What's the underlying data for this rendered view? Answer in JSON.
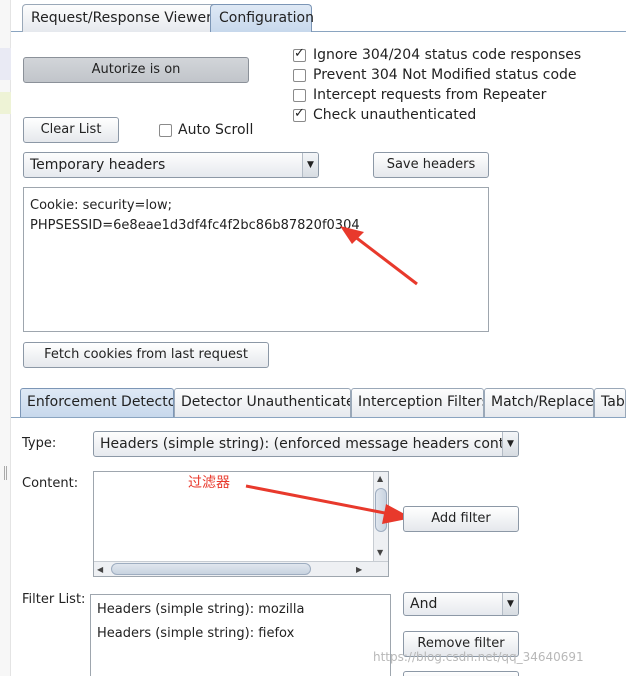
{
  "top_tabs": [
    {
      "label": "Request/Response Viewers",
      "selected": false
    },
    {
      "label": "Configuration",
      "selected": true
    }
  ],
  "config": {
    "autorize_button": "Autorize is on",
    "clear_list_button": "Clear List",
    "auto_scroll_label": "Auto Scroll",
    "auto_scroll_checked": false,
    "options": [
      {
        "label": "Ignore 304/204 status code responses",
        "checked": true
      },
      {
        "label": "Prevent 304 Not Modified status code",
        "checked": false
      },
      {
        "label": "Intercept requests from Repeater",
        "checked": false
      },
      {
        "label": "Check unauthenticated",
        "checked": true
      }
    ],
    "headers_select": "Temporary headers",
    "save_headers_button": "Save headers",
    "headers_text_line1": "Cookie: security=low;",
    "headers_text_line2": "PHPSESSID=6e8eae1d3df4fc4f2bc86b87820f0304",
    "fetch_cookies_button": "Fetch cookies from last request"
  },
  "enforcement_tabs": [
    {
      "label": "Enforcement Detector",
      "selected": true
    },
    {
      "label": "Detector Unauthenticated",
      "selected": false
    },
    {
      "label": "Interception Filters",
      "selected": false
    },
    {
      "label": "Match/Replace",
      "selected": false
    },
    {
      "label": "Tab",
      "selected": false
    }
  ],
  "filter": {
    "type_label": "Type:",
    "type_value": "Headers (simple string): (enforced message headers contains)",
    "content_label": "Content:",
    "content_value": "",
    "add_filter_button": "Add filter",
    "filter_list_label": "Filter List:",
    "filter_list_items": [
      "Headers (simple string): mozilla",
      "Headers (simple string): fiefox"
    ],
    "logic_select": "And",
    "remove_filter_button": "Remove filter"
  },
  "annotations": {
    "filter_note": "过滤器",
    "annotation_color": "#e8392c"
  },
  "watermark": "https://blog.csdn.net/qq_34640691"
}
